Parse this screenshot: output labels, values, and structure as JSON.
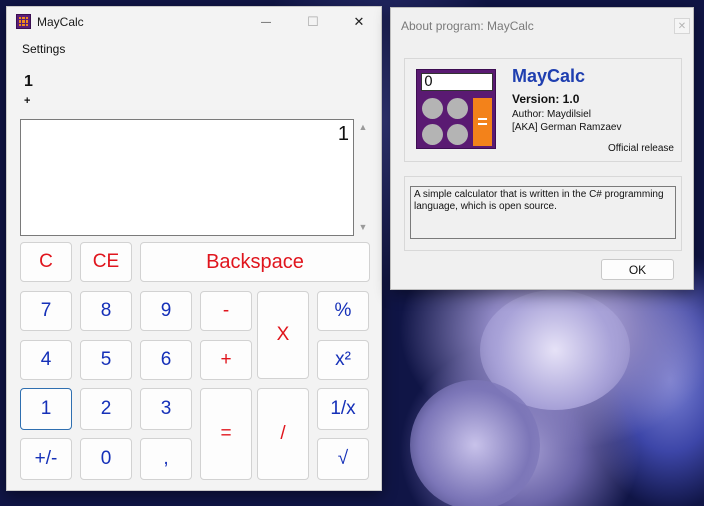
{
  "calculator": {
    "title": "MayCalc",
    "window_controls": {
      "minimize": "—",
      "maximize": "☐",
      "close": "✕"
    },
    "menu": {
      "settings": "Settings"
    },
    "history": {
      "value": "1",
      "operator": "+"
    },
    "display": {
      "value": "1"
    },
    "scroll": {
      "up": "▲",
      "down": "▼"
    },
    "buttons": {
      "clear": "C",
      "clear_entry": "CE",
      "backspace": "Backspace",
      "seven": "7",
      "eight": "8",
      "nine": "9",
      "four": "4",
      "five": "5",
      "six": "6",
      "one": "1",
      "two": "2",
      "three": "3",
      "negate": "+/-",
      "zero": "0",
      "decimal": ",",
      "minus": "-",
      "plus": "+",
      "multiply": "X",
      "divide": "/",
      "equals": "=",
      "percent": "%",
      "square": "x²",
      "reciprocal": "1/x",
      "sqrt": "√"
    }
  },
  "about": {
    "title": "About program: MayCalc",
    "close": "✕",
    "logo_screen": "0",
    "logo_equals": "=",
    "app_name": "MayCalc",
    "version": "Version: 1.0",
    "author": "Author: Maydilsiel",
    "aka": "[AKA] German Ramzaev",
    "release": "Official release",
    "description": "A simple calculator that is written in the C# programming language, which is open source.",
    "ok": "OK"
  },
  "colors": {
    "digit_text": "#1530b8",
    "operator_text": "#e0151d",
    "logo_purple": "#5a1a72",
    "logo_orange": "#f3821a",
    "about_name": "#1f3fb0"
  }
}
